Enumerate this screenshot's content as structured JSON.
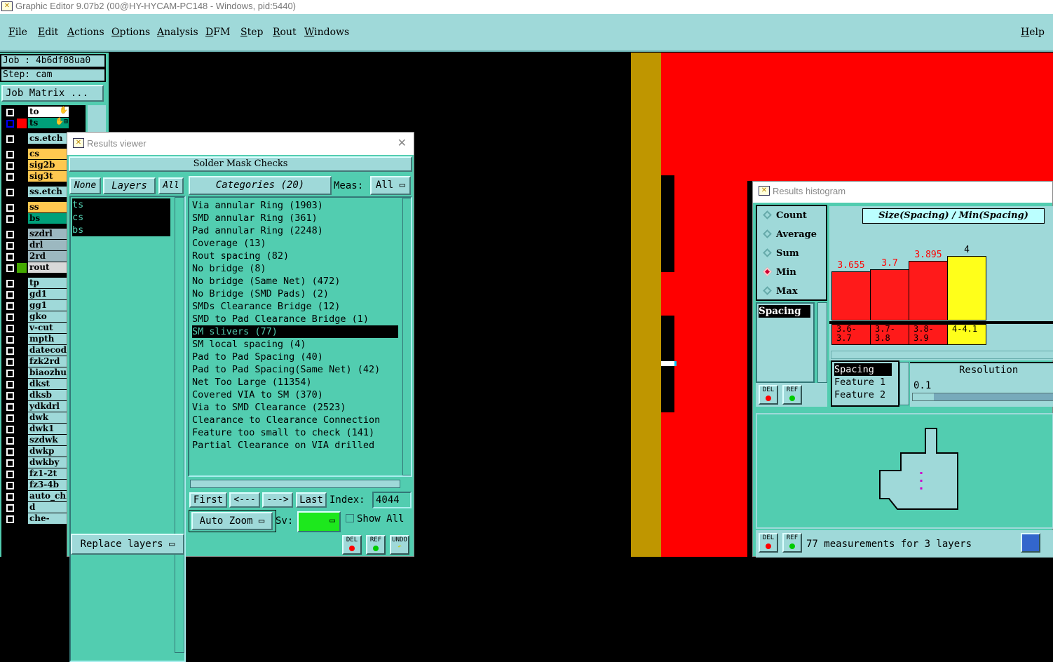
{
  "window_title": "Graphic Editor 9.07b2 (00@HY-HYCAM-PC148 - Windows, pid:5440)",
  "menu": [
    "File",
    "Edit",
    "Actions",
    "Options",
    "Analysis",
    "DFM",
    "Step",
    "Rout",
    "Windows"
  ],
  "help": "Help",
  "job": "Job : 4b6df08ua0",
  "step": "Step: cam",
  "job_matrix": "Job Matrix ...",
  "layers": [
    {
      "name": "to",
      "color": "#ffffff",
      "group": 0,
      "mark": "✋"
    },
    {
      "name": "ts",
      "color": "#00a07a",
      "group": 0,
      "mark": "✋⊞",
      "selected": true
    },
    {
      "name": "cs.etch",
      "color": "#9fd9d9",
      "group": 1
    },
    {
      "name": "cs",
      "color": "#ffc850",
      "group": 2
    },
    {
      "name": "sig2b",
      "color": "#ffc850",
      "group": 2
    },
    {
      "name": "sig3t",
      "color": "#ffc850",
      "group": 2
    },
    {
      "name": "ss.etch",
      "color": "#9fd9d9",
      "group": 3
    },
    {
      "name": "ss",
      "color": "#ffc850",
      "group": 4
    },
    {
      "name": "bs",
      "color": "#00a07a",
      "group": 4
    },
    {
      "name": "szdrl",
      "color": "#9cb8c0",
      "group": 5
    },
    {
      "name": "drl",
      "color": "#9cb8c0",
      "group": 5
    },
    {
      "name": "2rd",
      "color": "#9cb8c0",
      "group": 5
    },
    {
      "name": "rout",
      "color": "#d8d8d8",
      "group": 5
    },
    {
      "name": "tp",
      "color": "#9fd9d9",
      "group": 6
    },
    {
      "name": "gd1",
      "color": "#9fd9d9",
      "group": 6
    },
    {
      "name": "gg1",
      "color": "#9fd9d9",
      "group": 6
    },
    {
      "name": "gko",
      "color": "#9fd9d9",
      "group": 6
    },
    {
      "name": "v-cut",
      "color": "#9fd9d9",
      "group": 6
    },
    {
      "name": "mpth",
      "color": "#9fd9d9",
      "group": 6
    },
    {
      "name": "datecode",
      "color": "#9fd9d9",
      "group": 6
    },
    {
      "name": "fzk2rd",
      "color": "#9fd9d9",
      "group": 6
    },
    {
      "name": "biaozhu",
      "color": "#9fd9d9",
      "group": 6
    },
    {
      "name": "dkst",
      "color": "#9fd9d9",
      "group": 6
    },
    {
      "name": "dksb",
      "color": "#9fd9d9",
      "group": 6
    },
    {
      "name": "ydkdrl",
      "color": "#9fd9d9",
      "group": 6
    },
    {
      "name": "dwk",
      "color": "#9fd9d9",
      "group": 6
    },
    {
      "name": "dwk1",
      "color": "#9fd9d9",
      "group": 6
    },
    {
      "name": "szdwk",
      "color": "#9fd9d9",
      "group": 6
    },
    {
      "name": "dwkp",
      "color": "#9fd9d9",
      "group": 6
    },
    {
      "name": "dwkby",
      "color": "#9fd9d9",
      "group": 6
    },
    {
      "name": "fz1-2t",
      "color": "#9fd9d9",
      "group": 6
    },
    {
      "name": "fz3-4b",
      "color": "#9fd9d9",
      "group": 6
    },
    {
      "name": "auto_chk",
      "color": "#9fd9d9",
      "group": 6
    },
    {
      "name": "d",
      "color": "#9fd9d9",
      "group": 6
    },
    {
      "name": "che-pro-",
      "color": "#9fd9d9",
      "group": 6
    }
  ],
  "results_viewer": {
    "title": "Results viewer",
    "header": "Solder Mask Checks",
    "none": "None",
    "layers_label": "Layers",
    "all": "All",
    "selected_layers": [
      "ts",
      "cs",
      "bs"
    ],
    "categories_label": "Categories (20)",
    "meas_label": "Meas:",
    "meas_value": "All",
    "categories": [
      "Via annular Ring (1903)",
      "SMD annular Ring (361)",
      "Pad annular Ring (2248)",
      "Coverage (13)",
      "Rout spacing (82)",
      "No bridge (8)",
      "No bridge (Same Net) (472)",
      "No Bridge (SMD Pads) (2)",
      "SMDs Clearance Bridge (12)",
      "SMD to Pad Clearance Bridge (1)",
      "SM slivers (77)",
      "SM local spacing (4)",
      "Pad to Pad Spacing (40)",
      "Pad to Pad Spacing(Same Net) (42)",
      "Net Too Large (11354)",
      "Covered VIA to SM (370)",
      "Via to SMD Clearance (2523)",
      "Clearance to Clearance Connection",
      "Feature too small to check (141)",
      "Partial Clearance on VIA drilled"
    ],
    "selected_category": 10,
    "first": "First",
    "prev": "<---",
    "next": "--->",
    "last": "Last",
    "index_label": "Index:",
    "index_value": "4044",
    "auto_zoom": "Auto Zoom",
    "sv_label": "Sv:",
    "show_all": "Show All",
    "replace_layers": "Replace layers",
    "del": "DEL",
    "ref": "REF",
    "undo": "UNDO"
  },
  "histogram": {
    "title": "Results histogram",
    "modes": [
      "Count",
      "Average",
      "Sum",
      "Min",
      "Max"
    ],
    "selected_mode": "Min",
    "attr_list": [
      "Spacing"
    ],
    "chart_title": "Size(Spacing) / Min(Spacing)",
    "bins": [
      "3.6-3.7",
      "3.7-3.8",
      "3.8-3.9",
      "4-4.1"
    ],
    "values": [
      3.655,
      3.7,
      3.895,
      4
    ],
    "value_labels": [
      "3.655",
      "3.7",
      "3.895",
      "4"
    ],
    "bar_colors": [
      "#ff1a1a",
      "#ff1a1a",
      "#ff1a1a",
      "#ffff1a"
    ],
    "measure_list": [
      "Spacing",
      "Feature 1",
      "Feature 2"
    ],
    "resolution_label": "Resolution",
    "resolution_value": "0.1",
    "status": "77 measurements for 3 layers",
    "del": "DEL",
    "ref": "REF"
  }
}
